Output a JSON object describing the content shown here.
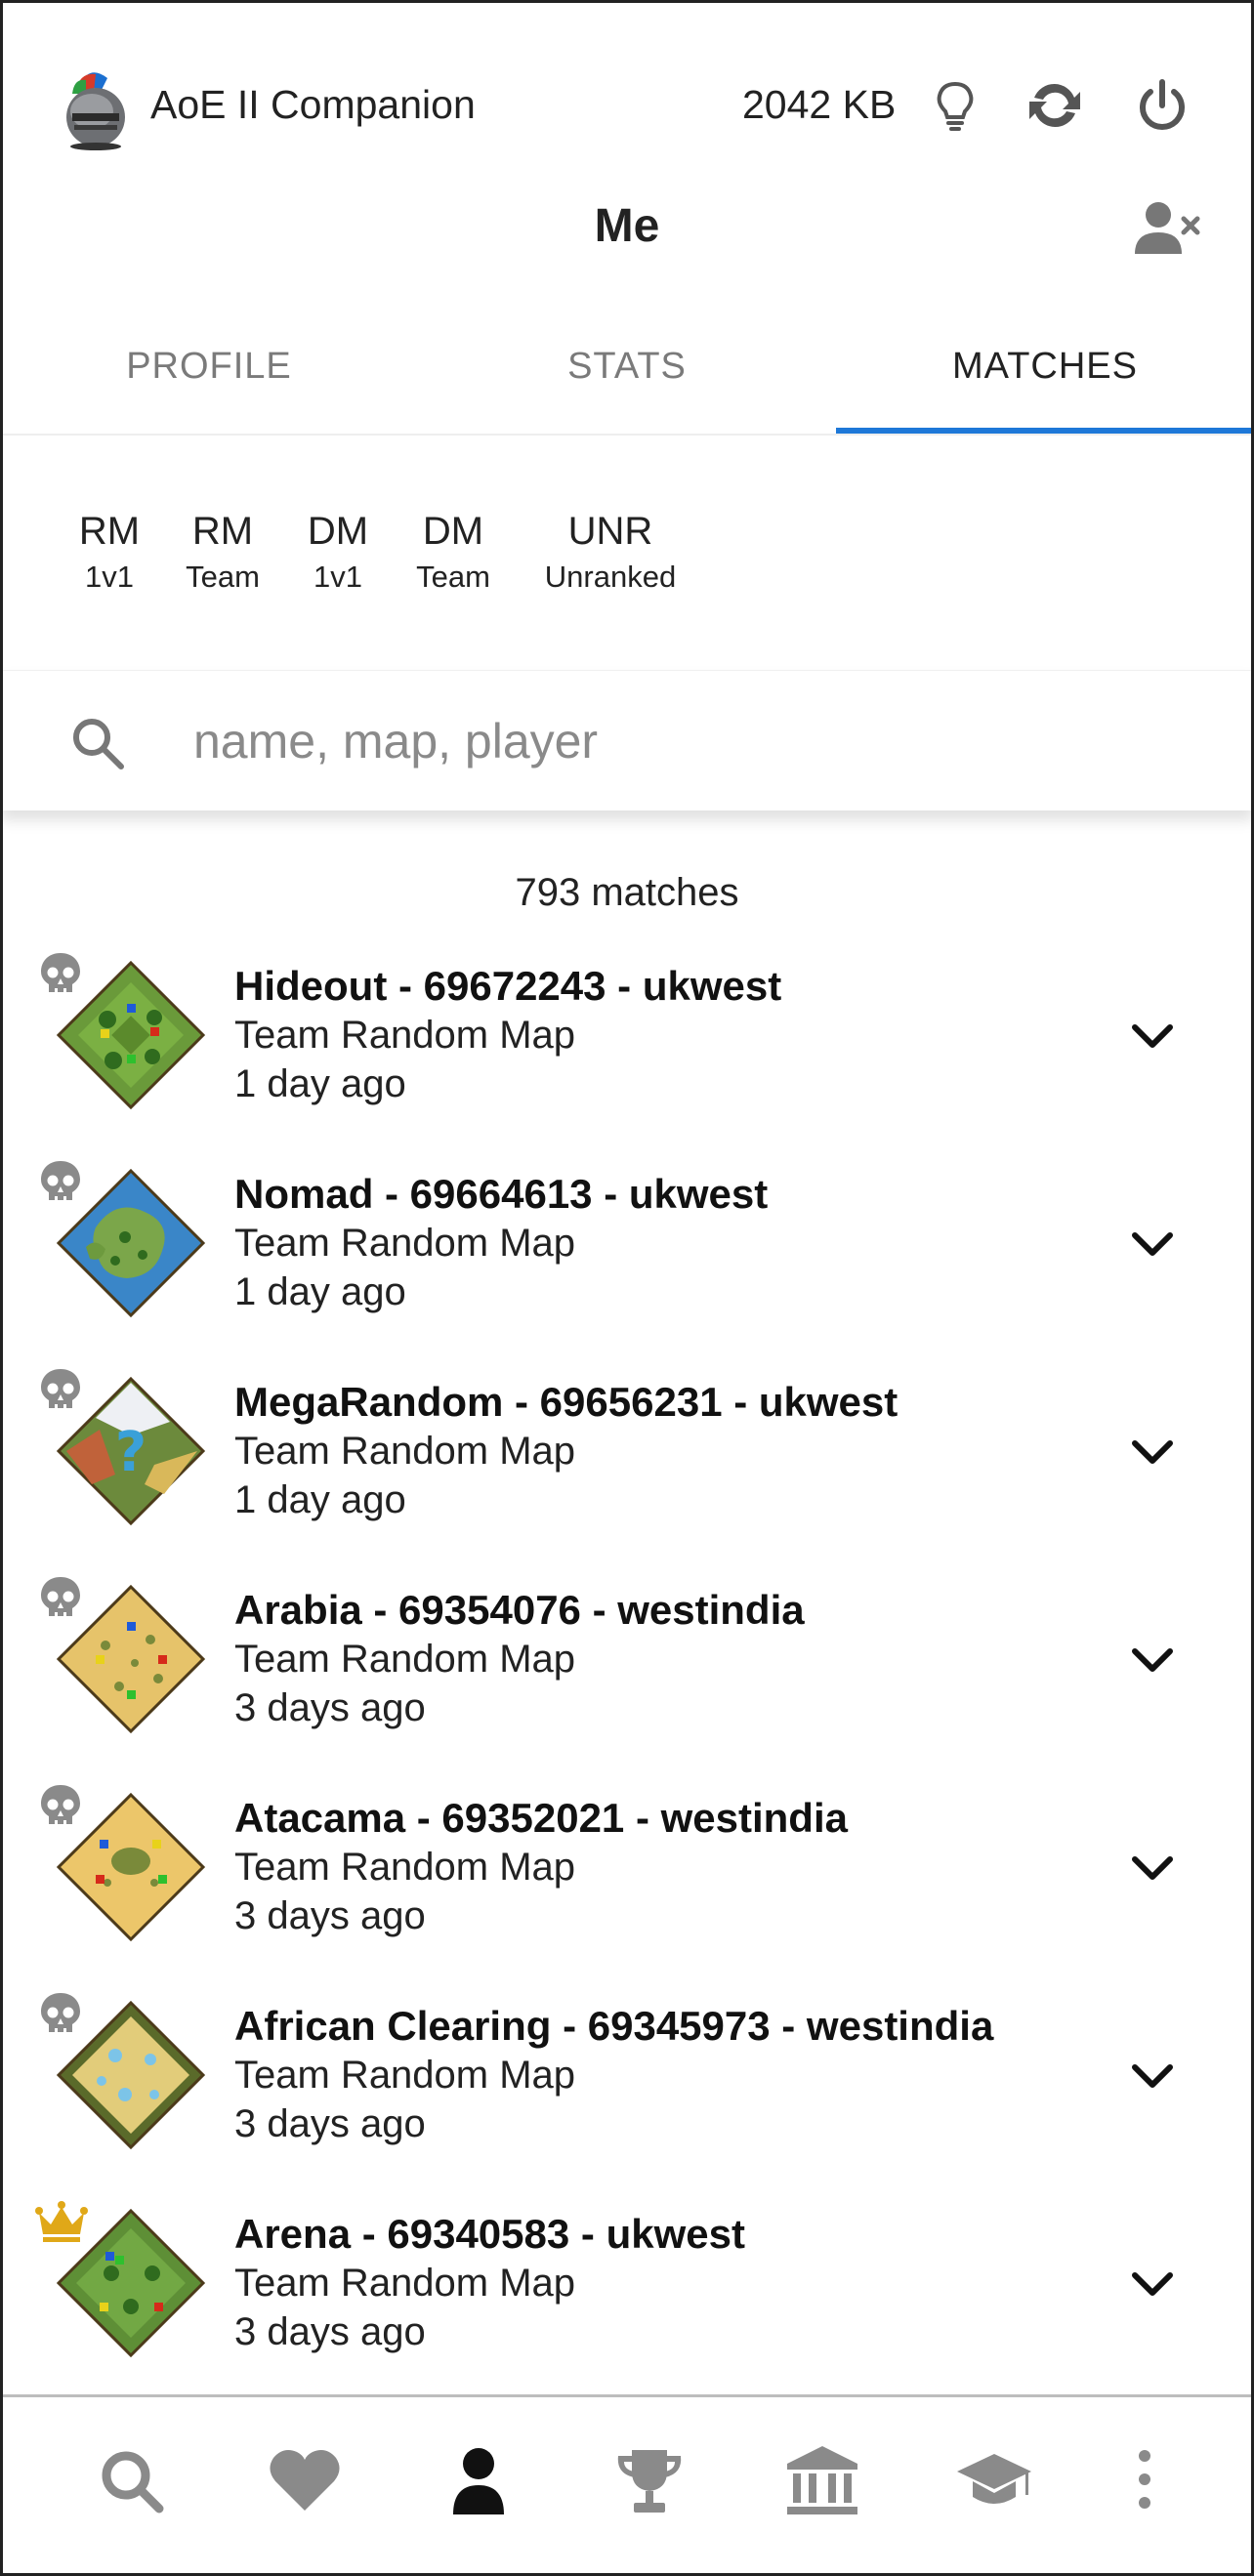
{
  "app": {
    "title": "AoE II Companion",
    "storage": "2042 KB"
  },
  "page": {
    "title": "Me"
  },
  "tabs": [
    {
      "label": "PROFILE",
      "active": false
    },
    {
      "label": "STATS",
      "active": false
    },
    {
      "label": "MATCHES",
      "active": true
    }
  ],
  "filters": [
    {
      "line1": "RM",
      "line2": "1v1"
    },
    {
      "line1": "RM",
      "line2": "Team"
    },
    {
      "line1": "DM",
      "line2": "1v1"
    },
    {
      "line1": "DM",
      "line2": "Team"
    },
    {
      "line1": "UNR",
      "line2": "Unranked"
    }
  ],
  "search": {
    "placeholder": "name, map, player",
    "value": ""
  },
  "matches_count": "793 matches",
  "matches": [
    {
      "title": "Hideout - 69672243 - ukwest",
      "type": "Team Random Map",
      "time": "1 day ago",
      "result": "loss",
      "map_icon": "hideout-map-icon"
    },
    {
      "title": "Nomad - 69664613 - ukwest",
      "type": "Team Random Map",
      "time": "1 day ago",
      "result": "loss",
      "map_icon": "nomad-map-icon"
    },
    {
      "title": "MegaRandom - 69656231 - ukwest",
      "type": "Team Random Map",
      "time": "1 day ago",
      "result": "loss",
      "map_icon": "megarandom-map-icon"
    },
    {
      "title": "Arabia - 69354076 - westindia",
      "type": "Team Random Map",
      "time": "3 days ago",
      "result": "loss",
      "map_icon": "arabia-map-icon"
    },
    {
      "title": "Atacama - 69352021 - westindia",
      "type": "Team Random Map",
      "time": "3 days ago",
      "result": "loss",
      "map_icon": "atacama-map-icon"
    },
    {
      "title": "African Clearing - 69345973 - westindia",
      "type": "Team Random Map",
      "time": "3 days ago",
      "result": "loss",
      "map_icon": "african-clearing-map-icon"
    },
    {
      "title": "Arena - 69340583 - ukwest",
      "type": "Team Random Map",
      "time": "3 days ago",
      "result": "win",
      "map_icon": "arena-map-icon"
    }
  ],
  "icons": {
    "header": [
      "lightbulb-icon",
      "refresh-icon",
      "power-icon",
      "remove-user-icon"
    ],
    "loss": "skull-icon",
    "win": "crown-icon",
    "bottom_nav": [
      "search-icon",
      "heart-icon",
      "person-icon",
      "trophy-icon",
      "museum-icon",
      "graduation-cap-icon",
      "more-vertical-icon"
    ]
  },
  "colors": {
    "accent": "#1e78d8",
    "loss_icon": "#8a8a8a",
    "win_icon": "#e0a818",
    "active_nav": "#111111",
    "inactive_nav": "#8a8a8a"
  }
}
